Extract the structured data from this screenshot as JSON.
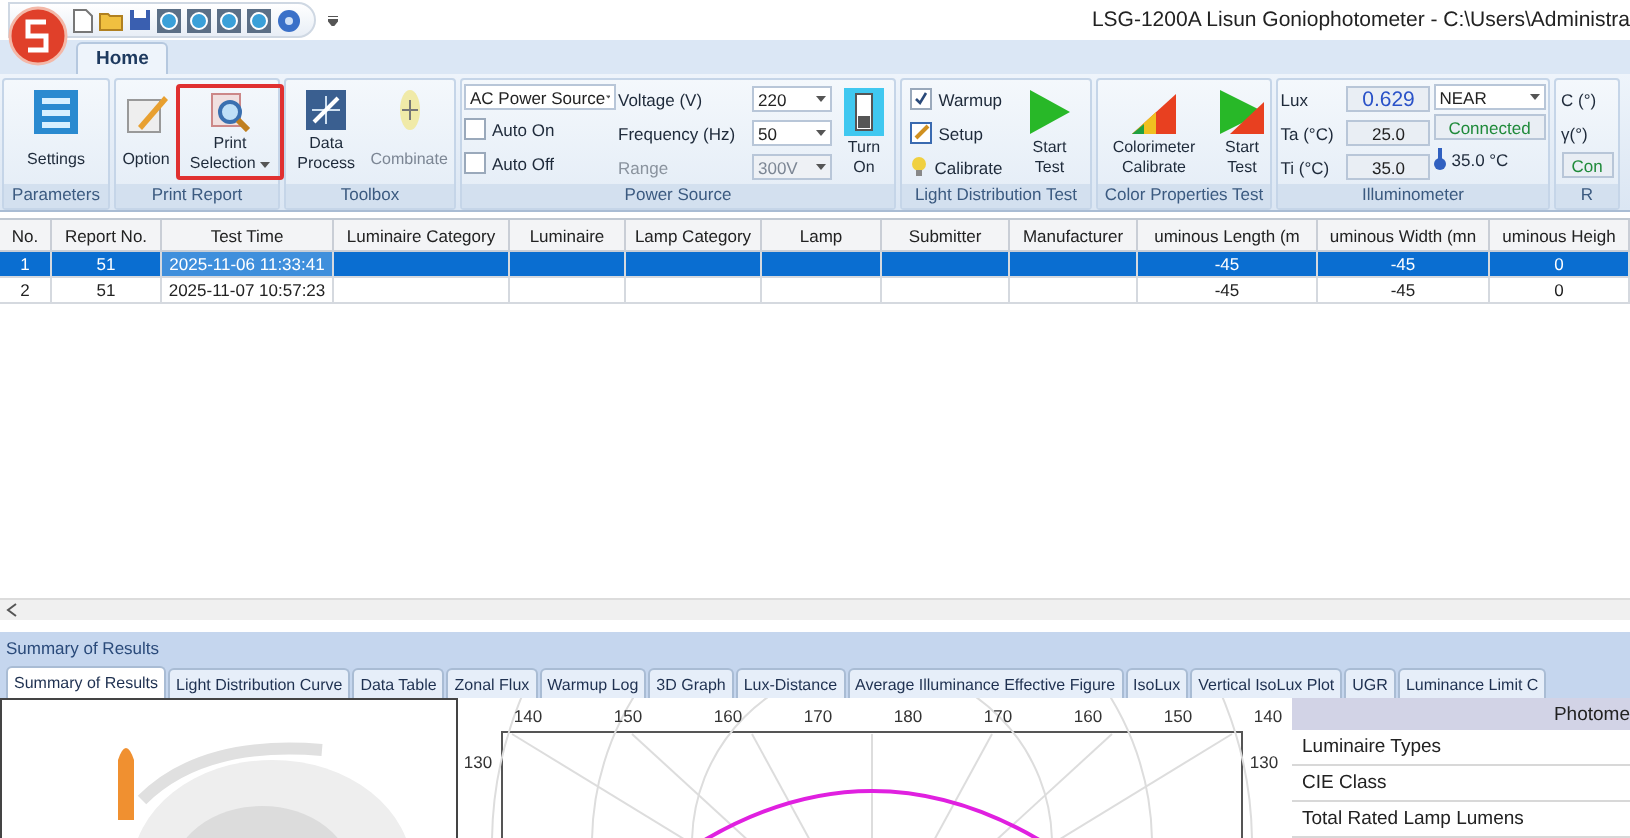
{
  "window": {
    "title": "LSG-1200A Lisun Goniophotometer  - C:\\Users\\Administra"
  },
  "ribbon_tabs": [
    {
      "label": "Home",
      "selected": true
    }
  ],
  "ribbon": {
    "settings": "Settings",
    "option": "Option",
    "print_selection": "Print Selection",
    "data_process": "Data Process",
    "combinate": "Combinate",
    "combinate_disabled": true,
    "power_source_type": "AC Power Source",
    "auto_on": {
      "label": "Auto On",
      "checked": false
    },
    "auto_off": {
      "label": "Auto Off",
      "checked": false
    },
    "voltage": {
      "label": "Voltage (V)",
      "value": "220"
    },
    "frequency": {
      "label": "Frequency (Hz)",
      "value": "50"
    },
    "range": {
      "label": "Range",
      "value": "300V",
      "disabled": true
    },
    "turn_on": "Turn On",
    "warmup": {
      "label": "Warmup",
      "checked": true
    },
    "setup": "Setup",
    "calibrate": "Calibrate",
    "start_test": "Start Test",
    "colorimeter_calibrate": "Colorimeter Calibrate",
    "color_start_test": "Start Test",
    "lux": {
      "label": "Lux",
      "value": "0.629"
    },
    "range_mode": "NEAR",
    "ta": {
      "label": "Ta (°C)",
      "value": "25.0"
    },
    "status": "Connected",
    "ti": {
      "label": "Ti (°C)",
      "value": "35.0"
    },
    "temperature": "35.0 °C",
    "c_label": "C (°)",
    "gamma_label": "γ(°)",
    "cut_status": "Con",
    "groups": [
      "Parameters",
      "Print Report",
      "Toolbox",
      "Power Source",
      "Light Distribution Test",
      "Color Properties Test",
      "Illuminometer",
      "R"
    ]
  },
  "table": {
    "columns": [
      "No.",
      "Report No.",
      "Test Time",
      "Luminaire Category",
      "Luminaire",
      "Lamp Category",
      "Lamp",
      "Submitter",
      "Manufacturer",
      "uminous Length (m",
      "uminous Width (mn",
      "uminous Heigh"
    ],
    "rows": [
      {
        "selected": true,
        "cells": [
          "1",
          "51",
          "2025-11-06 11:33:41",
          "",
          "",
          "",
          "",
          "",
          "",
          "-45",
          "-45",
          "0"
        ]
      },
      {
        "selected": false,
        "cells": [
          "2",
          "51",
          "2025-11-07 10:57:23",
          "",
          "",
          "",
          "",
          "",
          "",
          "-45",
          "-45",
          "0"
        ]
      }
    ]
  },
  "summary": {
    "title": "Summary of Results",
    "tabs": [
      {
        "label": "Summary of Results",
        "selected": true
      },
      {
        "label": "Light Distribution Curve",
        "selected": false
      },
      {
        "label": "Data Table",
        "selected": false
      },
      {
        "label": "Zonal Flux",
        "selected": false
      },
      {
        "label": "Warmup Log",
        "selected": false
      },
      {
        "label": "3D Graph",
        "selected": false
      },
      {
        "label": "Lux-Distance",
        "selected": false
      },
      {
        "label": "Average Illuminance Effective Figure",
        "selected": false
      },
      {
        "label": "IsoLux",
        "selected": false
      },
      {
        "label": "Vertical IsoLux Plot",
        "selected": false
      },
      {
        "label": "UGR",
        "selected": false
      },
      {
        "label": "Luminance Limit C",
        "selected": false
      }
    ],
    "polar_top_labels": [
      "140",
      "150",
      "160",
      "170",
      "180",
      "170",
      "160",
      "150",
      "140"
    ],
    "polar_side_labels": [
      "130",
      "130"
    ],
    "info_header": "Photome",
    "info_rows": [
      "Luminaire Types",
      "CIE Class",
      "Total Rated Lamp Lumens"
    ]
  }
}
